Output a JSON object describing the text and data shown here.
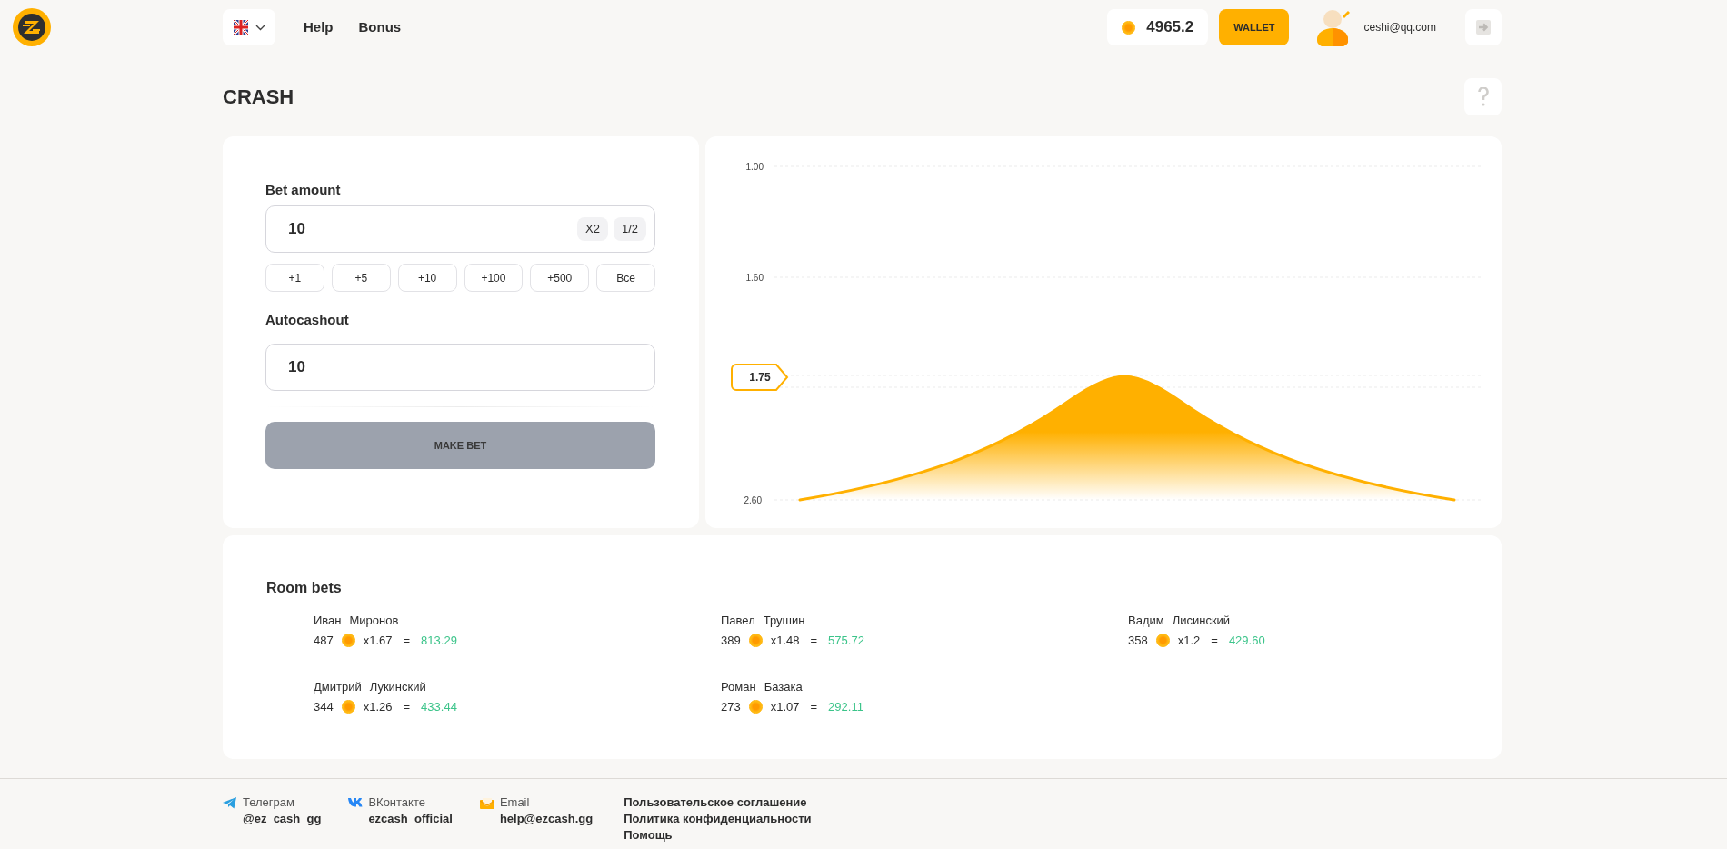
{
  "header": {
    "nav": [
      "Help",
      "Bonus"
    ],
    "balance": "4965.2",
    "wallet_button": "WALLET",
    "user_email": "ceshi@qq.com"
  },
  "page_title": "CRASH",
  "bet_form": {
    "bet_label": "Bet amount",
    "bet_value": "10",
    "multiply_buttons": [
      "X2",
      "1/2"
    ],
    "quick_buttons": [
      "+1",
      "+5",
      "+10",
      "+100",
      "+500",
      "Все"
    ],
    "autocashout_label": "Autocashout",
    "autocashout_value": "10",
    "submit_button": "MAKE BET",
    "submit_disabled": true
  },
  "chart": {
    "y_labels": [
      "1.00",
      "1.60",
      "2.60"
    ],
    "current_multiplier": "1.75"
  },
  "room_bets": {
    "title": "Room bets",
    "bets": [
      {
        "first_name": "Иван",
        "last_name": "Миронов",
        "amount": "487",
        "multiplier": "x1.67",
        "sign": "=",
        "payout": "813.29"
      },
      {
        "first_name": "Павел",
        "last_name": "Трушин",
        "amount": "389",
        "multiplier": "x1.48",
        "sign": "=",
        "payout": "575.72"
      },
      {
        "first_name": "Вадим",
        "last_name": "Лисинский",
        "amount": "358",
        "multiplier": "x1.2",
        "sign": "=",
        "payout": "429.60"
      },
      {
        "first_name": "Дмитрий",
        "last_name": "Лукинский",
        "amount": "344",
        "multiplier": "x1.26",
        "sign": "=",
        "payout": "433.44"
      },
      {
        "first_name": "Роман",
        "last_name": "Базака",
        "amount": "273",
        "multiplier": "x1.07",
        "sign": "=",
        "payout": "292.11"
      }
    ]
  },
  "footer": {
    "contacts": [
      {
        "kind": "telegram",
        "label": "Телеграм",
        "value": "@ez_cash_gg"
      },
      {
        "kind": "vk",
        "label": "ВКонтакте",
        "value": "ezcash_official"
      },
      {
        "kind": "email",
        "label": "Email",
        "value": "help@ezcash.gg"
      }
    ],
    "links": [
      "Пользовательское соглашение",
      "Политика конфиденциальности",
      "Помощь"
    ]
  }
}
